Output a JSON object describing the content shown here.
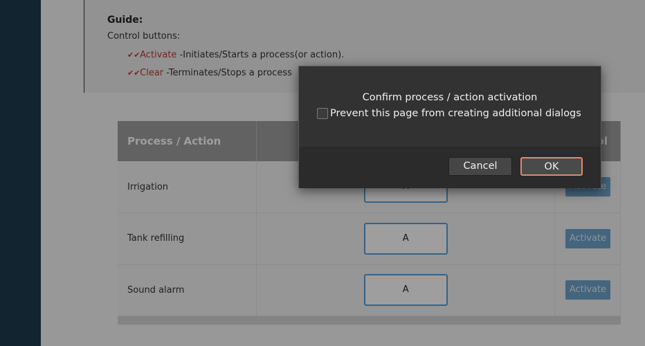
{
  "guide": {
    "title": "Guide:",
    "subtitle": "Control buttons:",
    "items": [
      {
        "keyword": "Activate",
        "text": " -Initiates/Starts a process(or action)."
      },
      {
        "keyword": "Clear",
        "text": " -Terminates/Stops a process"
      }
    ]
  },
  "table": {
    "headers": [
      "Process / Action",
      "",
      "Control"
    ],
    "visible_header_fragment": "ol",
    "rows": [
      {
        "name": "Irrigation",
        "mode": "A",
        "button": "Activate"
      },
      {
        "name": "Tank refilling",
        "mode": "A",
        "button": "Activate"
      },
      {
        "name": "Sound alarm",
        "mode": "A",
        "button": "Activate"
      }
    ]
  },
  "dialog": {
    "message": "Confirm process / action activation",
    "checkbox_label": "Prevent this page from creating additional dialogs",
    "checkbox_checked": false,
    "cancel_label": "Cancel",
    "ok_label": "OK"
  },
  "colors": {
    "sidebar": "#1e3a4c",
    "accent_red": "#c0392b",
    "button_blue": "#6fa3cc",
    "ok_focus": "#e08a6a"
  }
}
